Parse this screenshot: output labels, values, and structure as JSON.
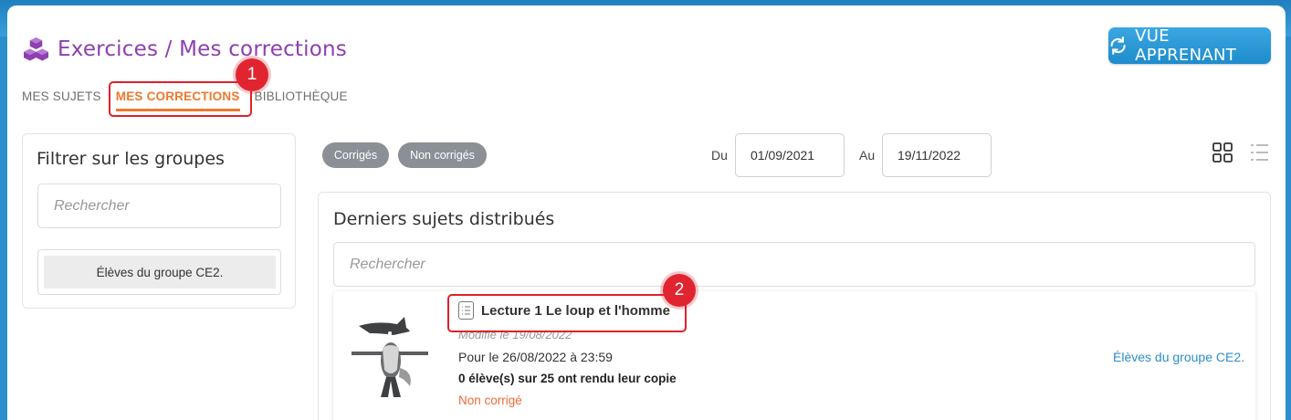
{
  "header": {
    "title": "Exercices / Mes corrections",
    "vue_button": "VUE APPRENANT"
  },
  "tabs": [
    {
      "label": "MES SUJETS",
      "active": false
    },
    {
      "label": "MES CORRECTIONS",
      "active": true
    },
    {
      "label": "BIBLIOTHÈQUE",
      "active": false
    }
  ],
  "annotations": [
    "1",
    "2"
  ],
  "sidebar": {
    "title": "Filtrer sur les groupes",
    "search_placeholder": "Rechercher",
    "group": "Élèves du groupe CE2."
  },
  "filters": {
    "corrected": "Corrigés",
    "not_corrected": "Non corrigés",
    "from_label": "Du",
    "from_date": "01/09/2021",
    "to_label": "Au",
    "to_date": "19/11/2022"
  },
  "main": {
    "title": "Derniers sujets distribués",
    "search_placeholder": "Rechercher",
    "items": [
      {
        "title": "Lecture 1 Le loup et l'homme",
        "modified": "Modifié le 19/08/2022",
        "due": "Pour le 26/08/2022 à 23:59",
        "returned": "0 élève(s) sur 25 ont rendu leur copie",
        "status": "Non corrigé",
        "group": "Élèves du groupe CE2."
      }
    ]
  },
  "colors": {
    "accent_purple": "#8e3fb0",
    "accent_orange": "#f0782c",
    "blue": "#2d8ec9",
    "annotation_red": "#e12530"
  }
}
